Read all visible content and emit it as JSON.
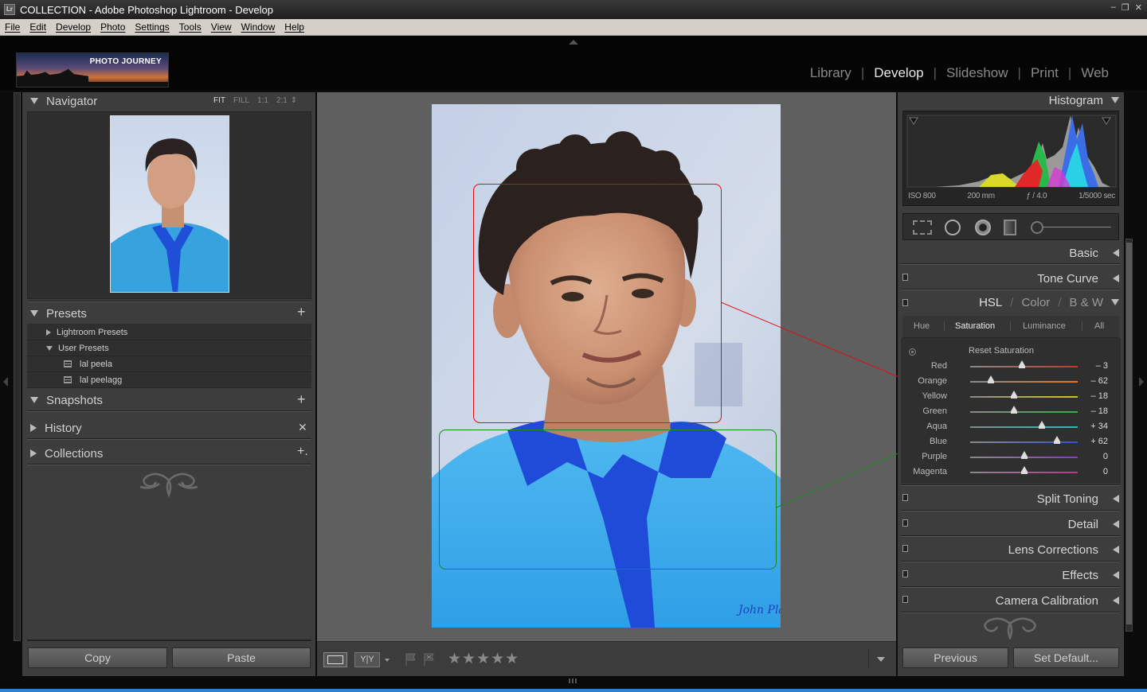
{
  "window": {
    "title": "COLLECTION - Adobe Photoshop Lightroom - Develop",
    "app_icon": "Lr",
    "controls": [
      "–",
      "❐",
      "✕"
    ]
  },
  "menu": [
    "File",
    "Edit",
    "Develop",
    "Photo",
    "Settings",
    "Tools",
    "View",
    "Window",
    "Help"
  ],
  "identity_plate": {
    "text": "PHOTO JOURNEY"
  },
  "modules": [
    "Library",
    "Develop",
    "Slideshow",
    "Print",
    "Web"
  ],
  "active_module": "Develop",
  "left": {
    "navigator": {
      "title": "Navigator",
      "zoom": [
        "FIT",
        "FILL",
        "1:1",
        "2:1"
      ],
      "zoom_extra": "⇕"
    },
    "presets": {
      "title": "Presets",
      "add": "+",
      "folders": [
        {
          "label": "Lightroom Presets",
          "expanded": false
        },
        {
          "label": "User Presets",
          "expanded": true
        }
      ],
      "items": [
        "lal peela",
        "lal peelagg"
      ]
    },
    "snapshots": {
      "title": "Snapshots",
      "action": "+"
    },
    "history": {
      "title": "History",
      "action": "✕"
    },
    "collections": {
      "title": "Collections",
      "action": "+."
    },
    "copy_label": "Copy",
    "paste_label": "Paste"
  },
  "right": {
    "histogram": {
      "title": "Histogram",
      "info": [
        "ISO 800",
        "200 mm",
        "ƒ / 4.0",
        "1/5000 sec"
      ]
    },
    "basic": "Basic",
    "tone_curve": "Tone Curve",
    "hsl": {
      "modes": [
        "HSL",
        "Color",
        "B & W"
      ],
      "seps": [
        "/",
        "/"
      ],
      "tabs": [
        "Hue",
        "Saturation",
        "Luminance",
        "All"
      ],
      "active_tab": "Saturation",
      "reset_label": "Reset Saturation",
      "sliders": [
        {
          "label": "Red",
          "value": "– 3",
          "num": -3,
          "color": "#c0392b"
        },
        {
          "label": "Orange",
          "value": "– 62",
          "num": -62,
          "color": "#e07a24"
        },
        {
          "label": "Yellow",
          "value": "– 18",
          "num": -18,
          "color": "#d4c02a"
        },
        {
          "label": "Green",
          "value": "– 18",
          "num": -18,
          "color": "#3aa845"
        },
        {
          "label": "Aqua",
          "value": "+ 34",
          "num": 34,
          "color": "#2cb8b8"
        },
        {
          "label": "Blue",
          "value": "+ 62",
          "num": 62,
          "color": "#3454d1"
        },
        {
          "label": "Purple",
          "value": "0",
          "num": 0,
          "color": "#8a3ac0"
        },
        {
          "label": "Magenta",
          "value": "0",
          "num": 0,
          "color": "#c2308f"
        }
      ]
    },
    "split_toning": "Split Toning",
    "detail": "Detail",
    "lens_corrections": "Lens Corrections",
    "effects": "Effects",
    "camera_calibration": "Camera Calibration",
    "previous_label": "Previous",
    "set_default_label": "Set Default..."
  },
  "toolbar": {
    "view_icons": [
      "loupe-view-icon",
      "before-after-icon"
    ],
    "yy_label": "Y|Y",
    "rating_stars": "★★★★★",
    "rating": 0
  },
  "photo": {
    "signature": "John Players"
  },
  "annotations": {
    "red_box_color": "#d11",
    "green_box_color": "#1a8a1a"
  }
}
